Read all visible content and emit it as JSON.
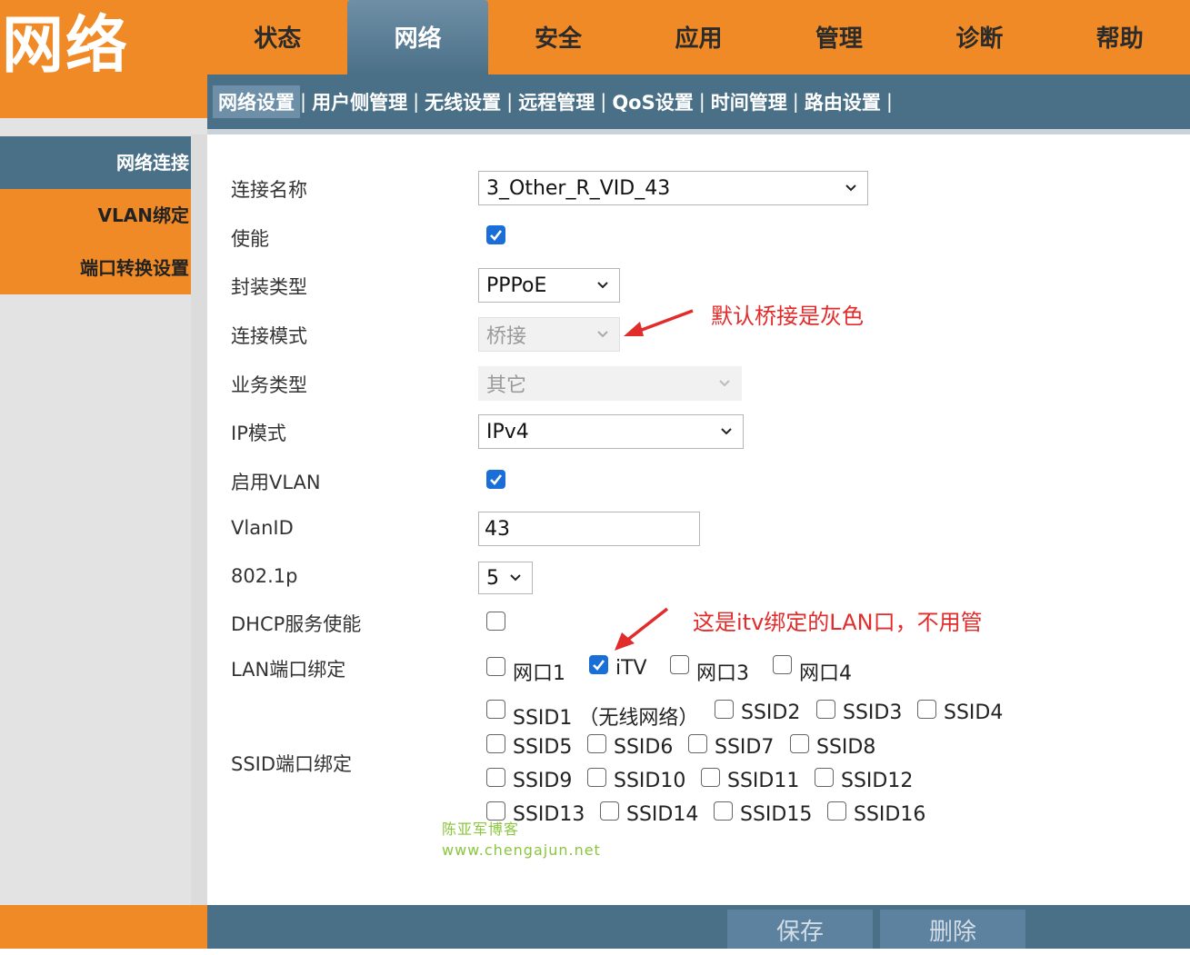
{
  "brand": {
    "title": "网络"
  },
  "top_nav": {
    "items": [
      {
        "label": "状态"
      },
      {
        "label": "网络",
        "active": true
      },
      {
        "label": "安全"
      },
      {
        "label": "应用"
      },
      {
        "label": "管理"
      },
      {
        "label": "诊断"
      },
      {
        "label": "帮助"
      }
    ]
  },
  "sub_nav": {
    "items": [
      {
        "label": "网络设置",
        "active": true
      },
      {
        "label": "用户侧管理"
      },
      {
        "label": "无线设置"
      },
      {
        "label": "远程管理"
      },
      {
        "label": "QoS设置"
      },
      {
        "label": "时间管理"
      },
      {
        "label": "路由设置"
      }
    ],
    "separator": "|"
  },
  "sidebar": {
    "items": [
      {
        "label": "网络连接",
        "active": true
      },
      {
        "label": "VLAN绑定"
      },
      {
        "label": "端口转换设置"
      }
    ]
  },
  "form": {
    "connection_name": {
      "label": "连接名称",
      "value": "3_Other_R_VID_43"
    },
    "enable": {
      "label": "使能",
      "checked": true
    },
    "encap_type": {
      "label": "封装类型",
      "value": "PPPoE"
    },
    "conn_mode": {
      "label": "连接模式",
      "value": "桥接",
      "disabled": true
    },
    "service_type": {
      "label": "业务类型",
      "value": "其它",
      "disabled": true
    },
    "ip_mode": {
      "label": "IP模式",
      "value": "IPv4"
    },
    "enable_vlan": {
      "label": "启用VLAN",
      "checked": true
    },
    "vlan_id": {
      "label": "VlanID",
      "value": "43"
    },
    "dot1p": {
      "label": "802.1p",
      "value": "5"
    },
    "dhcp_enable": {
      "label": "DHCP服务使能",
      "checked": false
    },
    "lan_binding": {
      "label": "LAN端口绑定",
      "ports": [
        {
          "label": "网口1",
          "checked": false
        },
        {
          "label": "iTV",
          "checked": true
        },
        {
          "label": "网口3",
          "checked": false
        },
        {
          "label": "网口4",
          "checked": false
        }
      ]
    },
    "ssid_binding": {
      "label": "SSID端口绑定",
      "ssids": [
        {
          "label": "SSID1 （无线网络）",
          "checked": false
        },
        {
          "label": "SSID2",
          "checked": false
        },
        {
          "label": "SSID3",
          "checked": false
        },
        {
          "label": "SSID4",
          "checked": false
        },
        {
          "label": "SSID5",
          "checked": false
        },
        {
          "label": "SSID6",
          "checked": false
        },
        {
          "label": "SSID7",
          "checked": false
        },
        {
          "label": "SSID8",
          "checked": false
        },
        {
          "label": "SSID9",
          "checked": false
        },
        {
          "label": "SSID10",
          "checked": false
        },
        {
          "label": "SSID11",
          "checked": false
        },
        {
          "label": "SSID12",
          "checked": false
        },
        {
          "label": "SSID13",
          "checked": false
        },
        {
          "label": "SSID14",
          "checked": false
        },
        {
          "label": "SSID15",
          "checked": false
        },
        {
          "label": "SSID16",
          "checked": false
        }
      ]
    }
  },
  "annotations": {
    "bridge_note": "默认桥接是灰色",
    "itv_note": "这是itv绑定的LAN口，不用管"
  },
  "watermark": {
    "line1": "陈亚军博客",
    "line2": "www.chengajun.net"
  },
  "footer": {
    "save_label": "保存",
    "delete_label": "删除"
  },
  "colors": {
    "orange": "#ef8a26",
    "steel_blue": "#4a7088",
    "checkbox_blue": "#1a6ed8",
    "annotation_red": "#e22b2b",
    "watermark_green": "#8bc63f"
  },
  "icons": {
    "dropdown": "chevron-down-icon",
    "check": "checkmark-icon",
    "annotation_arrow": "red-arrow-icon"
  }
}
